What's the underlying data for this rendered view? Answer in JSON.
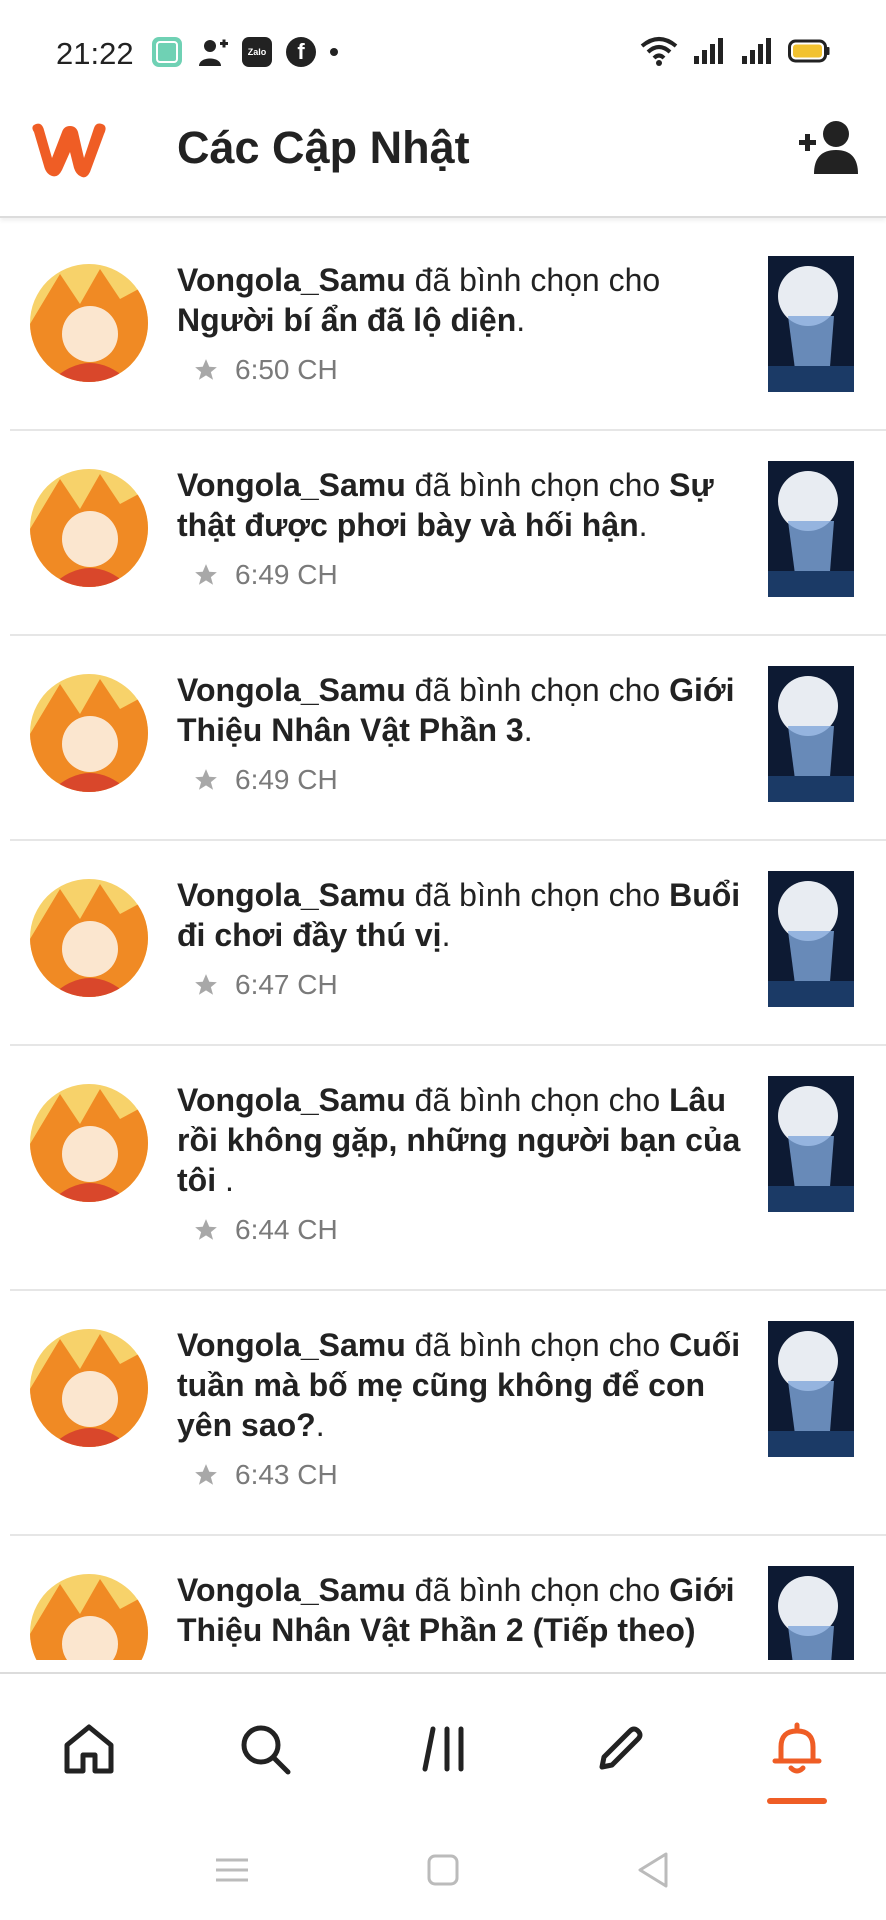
{
  "status_bar": {
    "time": "21:22",
    "app_icons": [
      "messages-app-icon",
      "contacts-icon",
      "zalo-icon",
      "facebook-icon",
      "more-dot-icon"
    ],
    "zalo_label": "Zalo",
    "facebook_label": "f",
    "battery_color": "#f2c230"
  },
  "header": {
    "title": "Các Cập Nhật",
    "brand_color": "#ef5d25"
  },
  "feed": [
    {
      "user": "Vongola_Samu",
      "action": "đã bình chọn cho",
      "story": "Người bí ẩn đã lộ diện",
      "time": "6:50 CH"
    },
    {
      "user": "Vongola_Samu",
      "action": "đã bình chọn cho",
      "story": "Sự thật được phơi bày và hối hận",
      "time": "6:49 CH"
    },
    {
      "user": "Vongola_Samu",
      "action": "đã bình chọn cho",
      "story": "Giới Thiệu Nhân Vật Phần 3",
      "time": "6:49 CH"
    },
    {
      "user": "Vongola_Samu",
      "action": "đã bình chọn cho",
      "story": "Buổi đi chơi đầy thú vị",
      "time": "6:47 CH"
    },
    {
      "user": "Vongola_Samu",
      "action": "đã bình chọn cho",
      "story": "Lâu rồi không gặp, những người bạn của tôi ",
      "time": "6:44 CH"
    },
    {
      "user": "Vongola_Samu",
      "action": "đã bình chọn cho",
      "story": "Cuối tuần mà bố mẹ cũng không để con yên sao?",
      "time": "6:43 CH"
    },
    {
      "user": "Vongola_Samu",
      "action": "đã bình chọn cho",
      "story": "Giới Thiệu Nhân Vật Phần 2 (Tiếp theo)",
      "time": ""
    }
  ],
  "punctuation": ".",
  "bottom_nav": {
    "items": [
      "home-tab",
      "search-tab",
      "library-tab",
      "write-tab",
      "notifications-tab"
    ],
    "active": "notifications-tab",
    "active_color": "#ef5d25"
  }
}
